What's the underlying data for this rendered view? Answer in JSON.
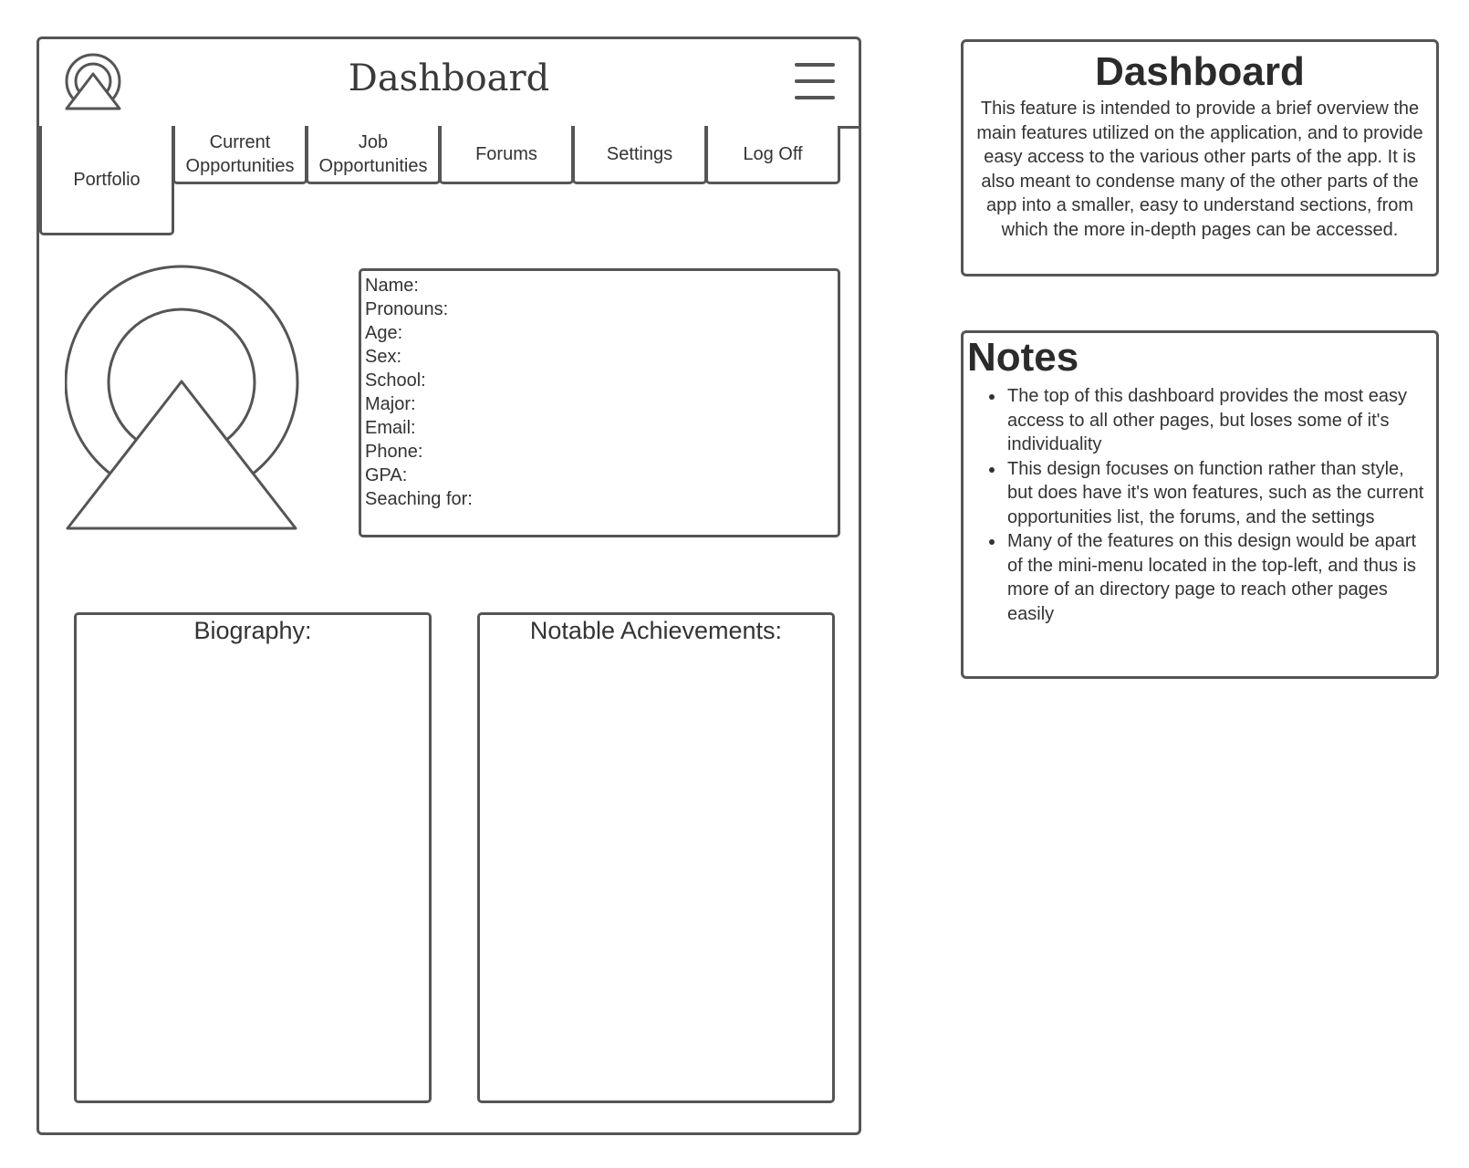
{
  "app": {
    "title": "Dashboard"
  },
  "tabs": [
    {
      "label": "Portfolio"
    },
    {
      "label": "Current\nOpportunities"
    },
    {
      "label": "Job\nOpportunities"
    },
    {
      "label": "Forums"
    },
    {
      "label": "Settings"
    },
    {
      "label": "Log Off"
    }
  ],
  "profile": {
    "fields": [
      "Name:",
      "Pronouns:",
      "Age:",
      "Sex:",
      "School:",
      "Major:",
      "Email:",
      "Phone:",
      "GPA:",
      "Seaching for:"
    ]
  },
  "panels": {
    "biography": "Biography:",
    "achievements": "Notable Achievements:"
  },
  "description": {
    "title": "Dashboard",
    "text": "This feature is intended to provide a brief overview the main features utilized on the application, and to provide easy access to the various other parts of the app. It is also meant to condense many of the other parts of the app into a smaller, easy to understand sections, from which the more in-depth pages can be accessed."
  },
  "notes": {
    "title": "Notes",
    "items": [
      "The top of this dashboard provides the most easy access to all other pages, but loses some of it's individuality",
      "This design focuses on function rather than style, but does have it's won features, such as the current opportunities list, the forums, and the settings",
      "Many of the features on this design would be apart of the mini-menu located in the top-left, and thus is more of an directory page to reach other pages easily"
    ]
  },
  "icons": {
    "logo": "profile-logo-icon",
    "menu": "hamburger-menu-icon",
    "avatar": "avatar-placeholder-icon"
  },
  "colors": {
    "stroke": "#555555",
    "text": "#333333",
    "background": "#ffffff"
  }
}
